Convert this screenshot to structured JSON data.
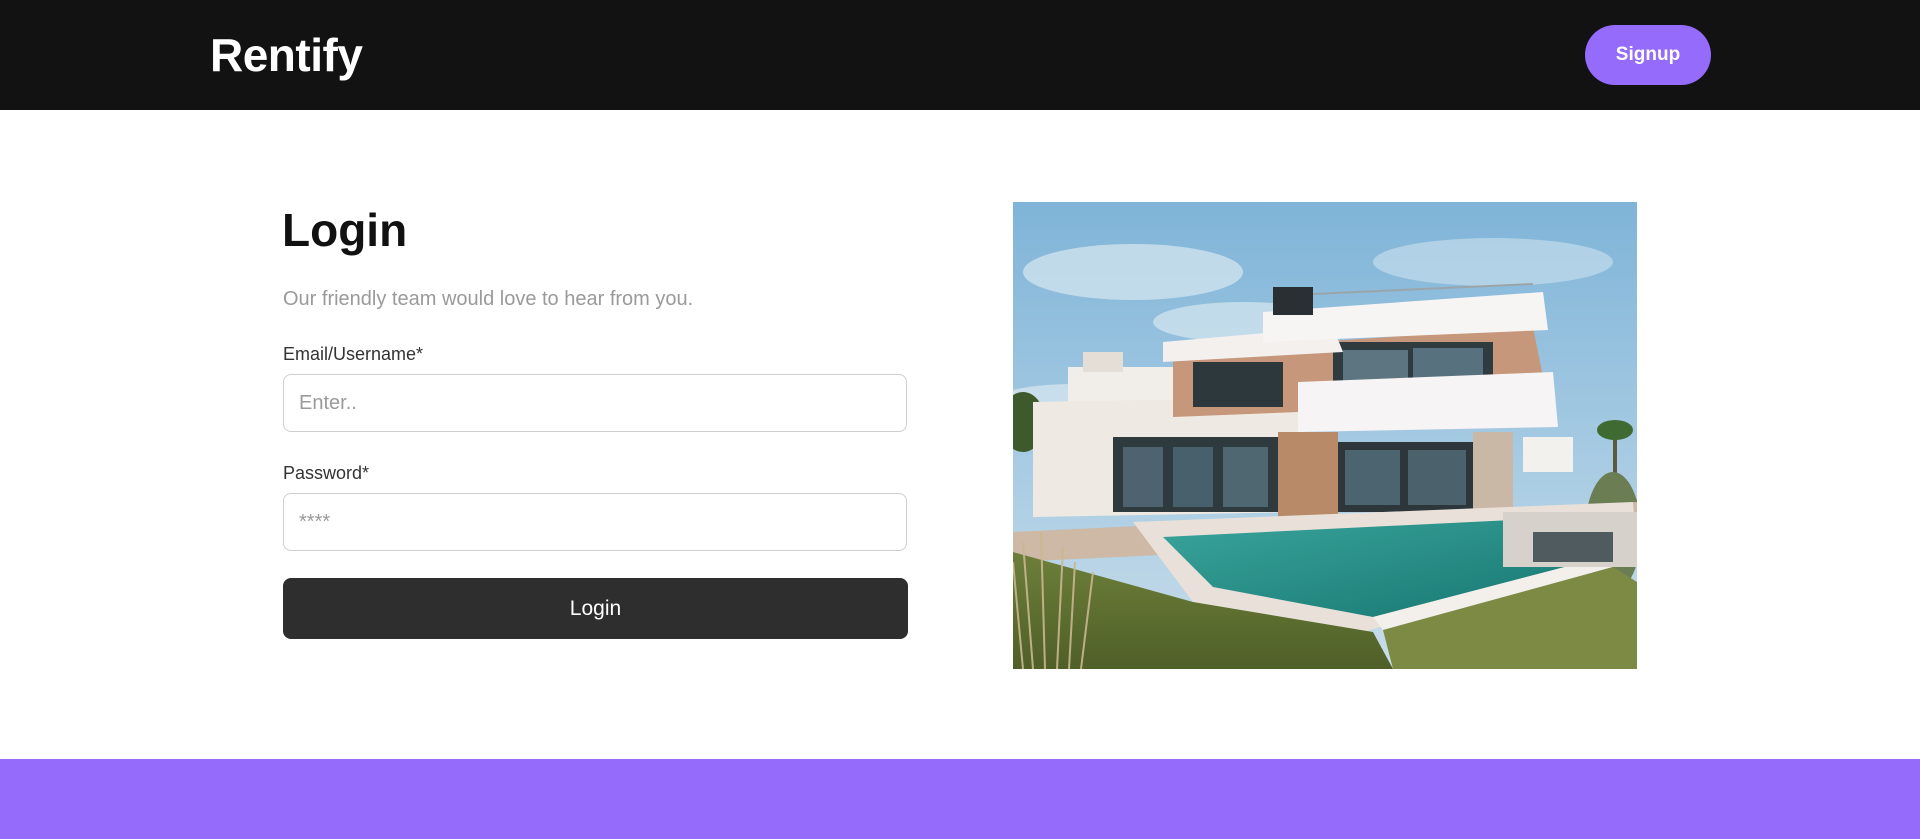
{
  "header": {
    "brand": "Rentify",
    "signup_label": "Signup"
  },
  "login": {
    "title": "Login",
    "subtitle": "Our friendly team would love to hear from you.",
    "email_label": "Email/Username*",
    "email_placeholder": "Enter..",
    "email_value": "",
    "password_label": "Password*",
    "password_placeholder": "****",
    "password_value": "",
    "submit_label": "Login"
  },
  "image": {
    "icon": "modern-house-with-pool-photo"
  },
  "colors": {
    "header_bg": "#121212",
    "accent": "#946bfb",
    "button_dark": "#2e2e2e",
    "muted_text": "#9a9a9a"
  }
}
